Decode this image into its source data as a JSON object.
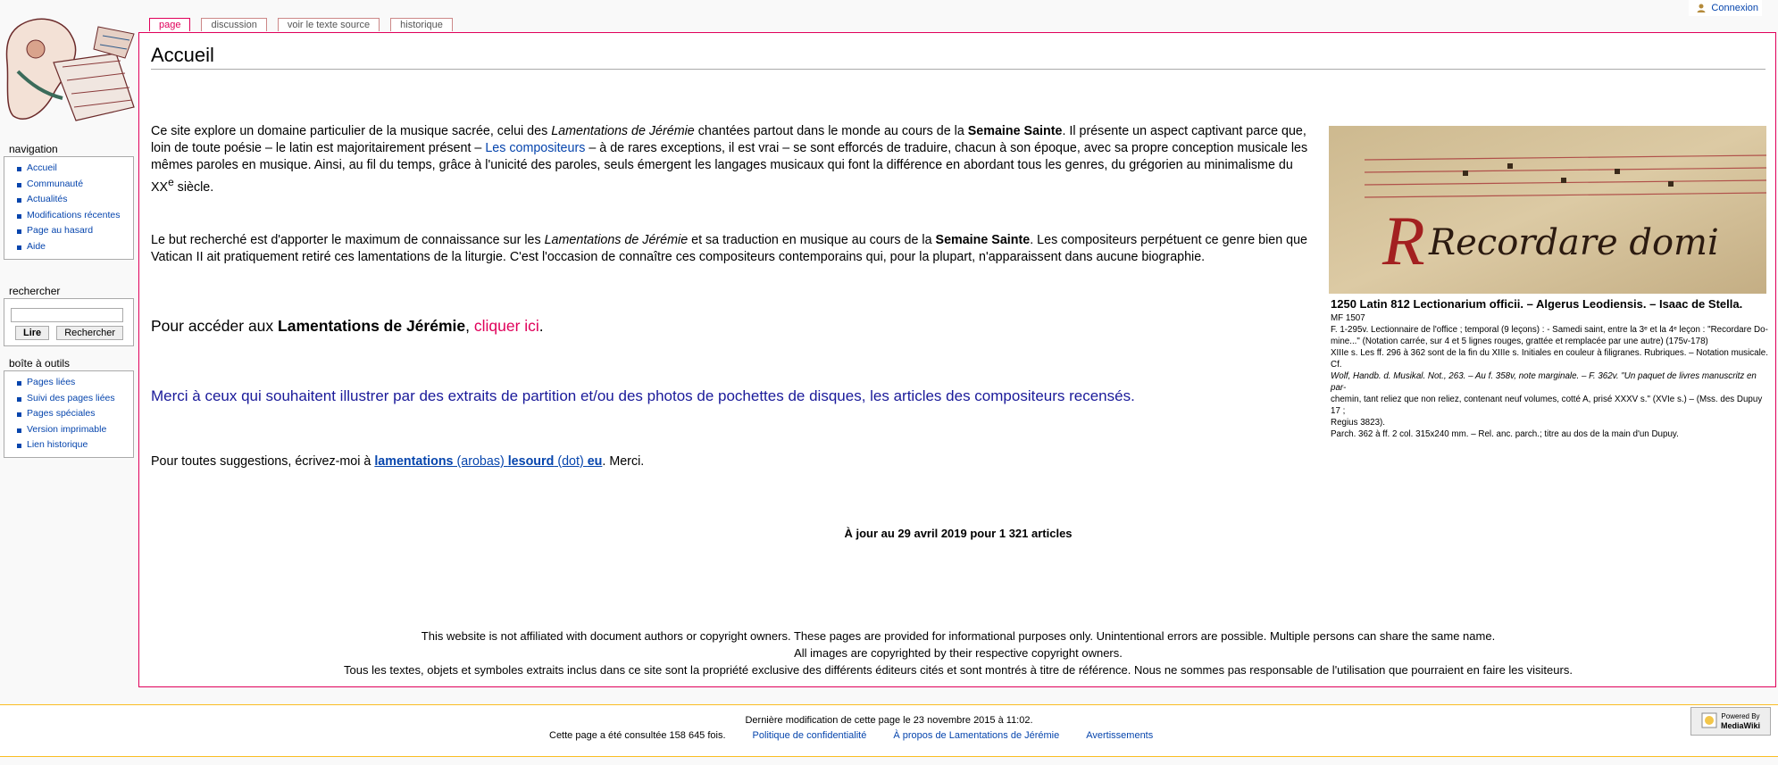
{
  "personal": {
    "login": "Connexion"
  },
  "tabs": [
    {
      "label": "page"
    },
    {
      "label": "discussion"
    },
    {
      "label": "voir le texte source"
    },
    {
      "label": "historique"
    }
  ],
  "page_title": "Accueil",
  "paragraph1": {
    "t1": "Ce site explore un domaine particulier de la musique sacrée, celui des ",
    "t2": "Lamentations de Jérémie",
    "t3": " chantées partout dans le monde au cours de la ",
    "t4": "Semaine Sainte",
    "t5": ". Il présente un aspect captivant parce que, loin de toute poésie – le latin est majoritairement présent – ",
    "link": "Les compositeurs",
    "t6": " – à de rares exceptions, il est vrai – se sont efforcés de traduire, chacun à son époque, avec sa propre conception musicale les mêmes paroles en musique. Ainsi, au fil du temps, grâce à l'unicité des paroles, seuls émergent les langages musicaux qui font la différence en abordant tous les genres, du grégorien au minimalisme du XX",
    "sup": "e",
    "t7": " siècle."
  },
  "paragraph2": {
    "t1": "Le but recherché est d'apporter le maximum de connaissance sur les ",
    "t2": "Lamentations de Jérémie",
    "t3": " et sa traduction en musique au cours de la ",
    "t4": "Semaine Sainte",
    "t5": ". Les compositeurs perpétuent ce genre bien que Vatican II ait pratiquement retiré ces lamentations de la liturgie. C'est l'occasion de connaître ces compositeurs contemporains qui, pour la plupart, n'apparaissent dans aucune biographie."
  },
  "paragraph3": {
    "t1": "Pour accéder aux ",
    "t2": "Lamentations de Jérémie",
    "t3": ", ",
    "link": "cliquer ici",
    "t4": "."
  },
  "paragraph4": "Merci à ceux qui souhaitent illustrer par des extraits de partition et/ou des photos de pochettes de disques, les articles des compositeurs recensés.",
  "paragraph5": {
    "t1": "Pour toutes suggestions, écrivez-moi à ",
    "e1": "lamentations",
    "e2": " (arobas) ",
    "e3": "lesourd",
    "e4": " (dot) ",
    "e5": "eu",
    "t2": ". Merci."
  },
  "uptodate": "À jour au 29 avril 2019 pour 1 321 articles",
  "disclaimer": [
    "This website is not affiliated with document authors or copyright owners. These pages are provided for informational purposes only. Unintentional errors are possible. Multiple persons can share the same name.",
    "All images are copyrighted by their respective copyright owners.",
    "Tous les textes, objets et symboles extraits inclus dans ce site sont la propriété exclusive des différents éditeurs cités et sont montrés à titre de référence. Nous ne sommes pas responsable de l'utilisation que pourraient en faire les visiteurs."
  ],
  "thumb": {
    "image_text": "Recordare domi",
    "caption": "1250 Latin 812 Lectionarium officii. – Algerus Leodiensis. – Isaac de Stella.",
    "notes": [
      "MF 1507",
      "F. 1-295v. Lectionnaire de l'office ; temporal (9 leçons) : - Samedi saint, entre la 3ᵉ et la 4ᵉ leçon : \"Recordare Do-",
      "mine...\" (Notation carrée, sur 4 et 5 lignes rouges, grattée et remplacée par une autre) (175v-178)",
      "XIIIe s. Les ff. 296 à 362 sont de la fin du XIIIe s. Initiales en couleur à filigranes. Rubriques. – Notation musicale. Cf.",
      "Wolf, Handb. d. Musikal. Not., 263. – Au f. 358v, note marginale. – F. 362v. \"Un paquet de livres manuscritz en par-",
      "chemin, tant reliez que non reliez, contenant neuf volumes, cotté A, prisé XXXV s.\" (XVIe s.) – (Mss. des Dupuy 17 ;",
      "Regius 3823).",
      "Parch. 362 à ff. 2 col. 315x240 mm. – Rel. anc. parch.; titre au dos de la main d'un Dupuy."
    ]
  },
  "sidebar": {
    "navigation": {
      "title": "navigation",
      "items": [
        {
          "label": "Accueil"
        },
        {
          "label": "Communauté"
        },
        {
          "label": "Actualités"
        },
        {
          "label": "Modifications récentes"
        },
        {
          "label": "Page au hasard"
        },
        {
          "label": "Aide"
        }
      ]
    },
    "search": {
      "title": "rechercher",
      "go": "Lire",
      "search": "Rechercher",
      "value": ""
    },
    "tools": {
      "title": "boîte à outils",
      "items": [
        {
          "label": "Pages liées"
        },
        {
          "label": "Suivi des pages liées"
        },
        {
          "label": "Pages spéciales"
        },
        {
          "label": "Version imprimable"
        },
        {
          "label": "Lien historique"
        }
      ]
    }
  },
  "footer": {
    "lastmod": "Dernière modification de cette page le 23 novembre 2015 à 11:02.",
    "viewcount": "Cette page a été consultée 158 645 fois.",
    "privacy": "Politique de confidentialité",
    "about": "À propos de Lamentations de Jérémie",
    "disclaimers": "Avertissements",
    "poweredby": [
      "Powered By",
      "MediaWiki"
    ]
  },
  "colors": {
    "accent": "#e0005a",
    "link": "#0645ad",
    "footer_border": "#fabd23",
    "appeal": "#1a1a9a"
  }
}
